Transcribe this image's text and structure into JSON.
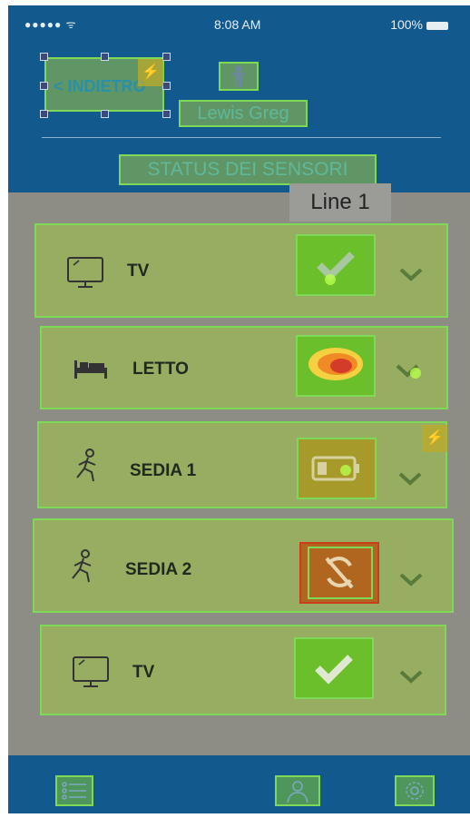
{
  "status_bar": {
    "signal": "●●●●● ᯤ",
    "time": "8:08 AM",
    "battery": "100%"
  },
  "header": {
    "back_label": "< INDIETRO",
    "user_name": "Lewis Greg",
    "section_title": "STATUS DEI SENSORI"
  },
  "tooltip": {
    "text": "Line 1"
  },
  "sensors": [
    {
      "label": "TV",
      "icon": "tv-icon",
      "status": "ok"
    },
    {
      "label": "LETTO",
      "icon": "bed-icon",
      "status": "alert"
    },
    {
      "label": "SEDIA 1",
      "icon": "running-person-icon",
      "status": "battery"
    },
    {
      "label": "SEDIA 2",
      "icon": "running-person-icon",
      "status": "sync-off"
    },
    {
      "label": "TV",
      "icon": "tv-icon",
      "status": "ok"
    }
  ],
  "footer": {
    "items": [
      "list-icon",
      "person-icon",
      "settings-gear-icon"
    ]
  },
  "colors": {
    "header": "#125a8e",
    "highlight": "#7ed957",
    "status_ok": "#5fae33",
    "status_alert": "#d43c2a"
  }
}
